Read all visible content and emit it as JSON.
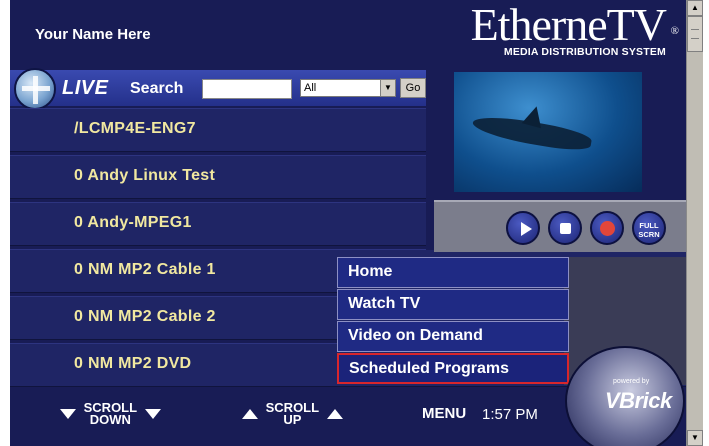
{
  "header": {
    "user_name": "Your Name Here",
    "brand_main": "Etherne",
    "brand_tv": "TV",
    "brand_reg": "®",
    "brand_sub": "MEDIA DISTRIBUTION SYSTEM"
  },
  "live_bar": {
    "live_label": "LIVE",
    "search_label": "Search",
    "search_value": "",
    "select_value": "All",
    "go_label": "Go"
  },
  "channels": [
    "/LCMP4E-ENG7",
    "0 Andy Linux Test",
    "0 Andy-MPEG1",
    "0 NM MP2 Cable 1",
    "0 NM MP2 Cable 2",
    "0 NM MP2 DVD"
  ],
  "controls": {
    "play": "play",
    "stop": "stop",
    "record": "record",
    "full_screen_line1": "FULL",
    "full_screen_line2": "SCRN"
  },
  "menu": {
    "items": [
      "Home",
      "Watch TV",
      "Video on Demand",
      "Scheduled Programs"
    ],
    "active_index": 3
  },
  "footer": {
    "scroll_down_line1": "SCROLL",
    "scroll_down_line2": "DOWN",
    "scroll_up_line1": "SCROLL",
    "scroll_up_line2": "UP",
    "menu_label": "MENU",
    "time": "1:57 PM",
    "powered_by": "powered by",
    "vbrick": "VBrick"
  },
  "colors": {
    "background": "#181c55",
    "channel_text": "#f1e8a0",
    "menu_highlight": "#d8262c"
  }
}
